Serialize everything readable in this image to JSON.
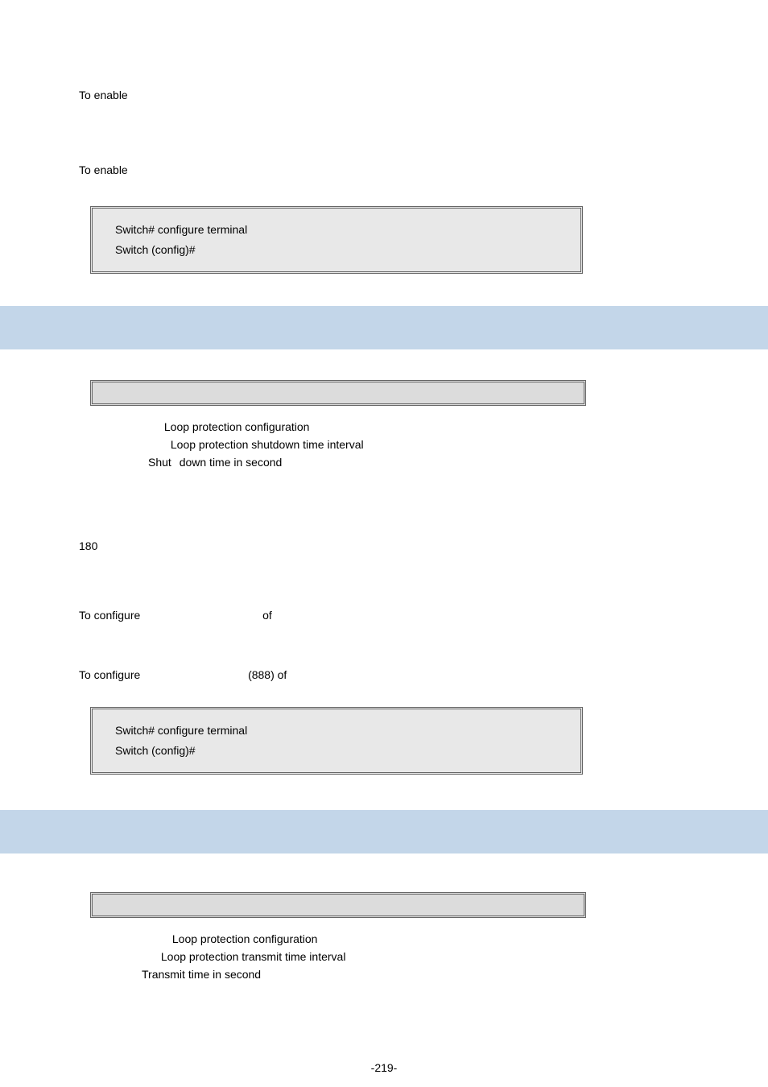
{
  "top": {
    "enable1": "To enable",
    "enable2": "To enable"
  },
  "code1": {
    "l1": "Switch# configure terminal",
    "l2": "Switch (config)#"
  },
  "sec1": {
    "param1_prefix": "Loop protection configuration",
    "param2_prefix": "Loop protection shutdown time interval",
    "param3_prefix": "Shut",
    "param3_rest": "down time in second",
    "default_val": "180",
    "usage_a": "To configure",
    "usage_mid": "of",
    "usage_b": "To configure",
    "usage_b_mid": "(888) of"
  },
  "code2": {
    "l1": "Switch# configure terminal",
    "l2": "Switch (config)#"
  },
  "sec2": {
    "param1": "Loop protection configuration",
    "param2": "Loop protection transmit time interval",
    "param3": "Transmit time in second"
  },
  "page_number": "-219-"
}
